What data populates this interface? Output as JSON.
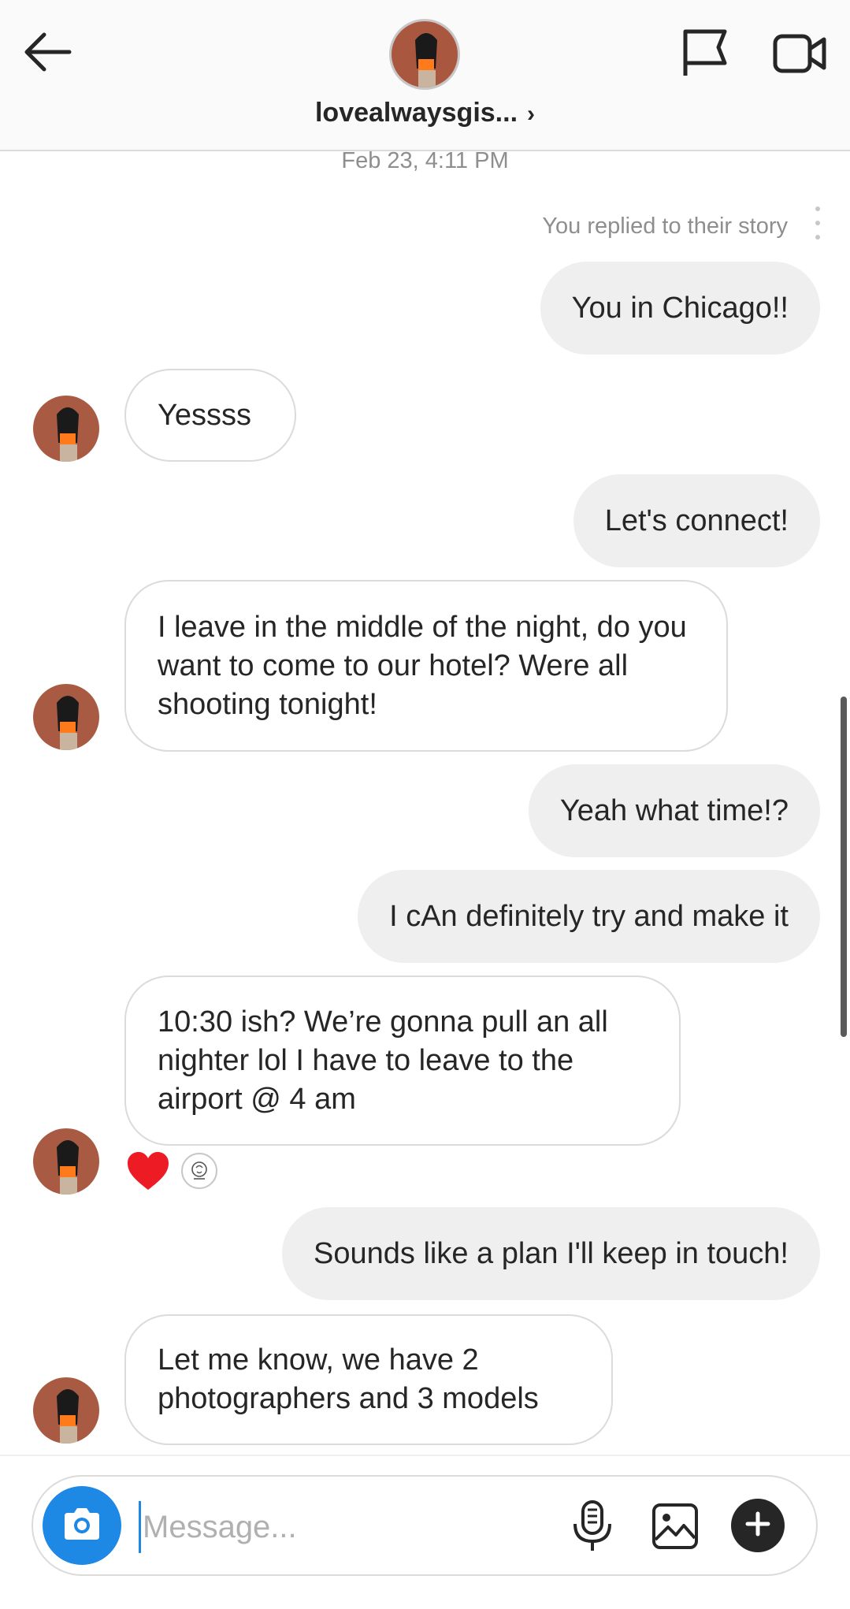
{
  "header": {
    "username": "lovealwaysgis...",
    "chevron": "›"
  },
  "chat": {
    "timestamp": "Feb 23, 4:11 PM",
    "story_reply_note": "You replied to their story",
    "messages": [
      {
        "from": "me",
        "text": "You in Chicago!!"
      },
      {
        "from": "them",
        "text": "Yessss"
      },
      {
        "from": "me",
        "text": "Let's connect!"
      },
      {
        "from": "them",
        "text": "I leave in the middle of the night, do you want to come to our hotel? Were all shooting tonight!"
      },
      {
        "from": "me",
        "text": "Yeah what time!?"
      },
      {
        "from": "me",
        "text": "I cAn definitely try and make it"
      },
      {
        "from": "them",
        "text": "10:30 ish? We’re gonna pull an all nighter lol I have to leave to the airport @ 4 am"
      },
      {
        "from": "me",
        "text": "Sounds like a plan I'll keep in touch!"
      },
      {
        "from": "them",
        "text": "Let me know, we have 2 photographers and 3 models"
      }
    ],
    "reactions": [
      "heart-icon",
      "reactor-avatar"
    ]
  },
  "composer": {
    "placeholder": "Message..."
  },
  "colors": {
    "accent": "#1e88e5",
    "sent_bubble": "#efefef",
    "heart": "#ed1c24"
  },
  "icons": [
    "back-arrow-icon",
    "flag-icon",
    "video-call-icon",
    "camera-icon",
    "microphone-icon",
    "image-icon",
    "plus-icon"
  ]
}
